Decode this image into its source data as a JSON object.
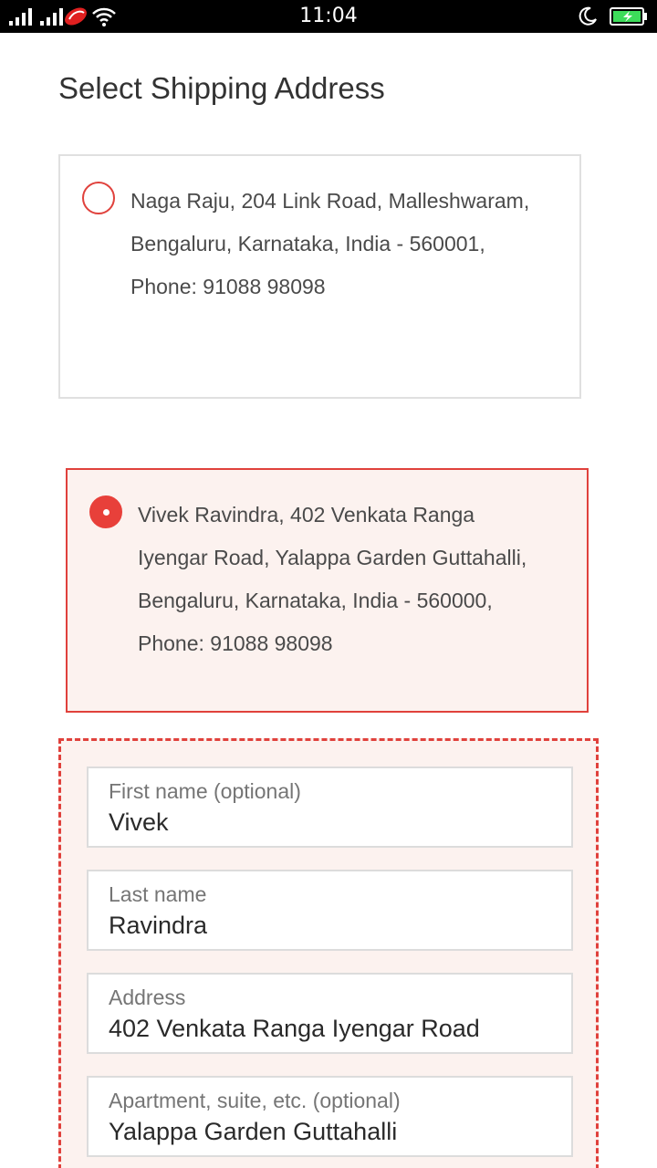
{
  "status_bar": {
    "time": "11:04"
  },
  "page": {
    "title": "Select Shipping Address"
  },
  "addresses": [
    {
      "text": "Naga Raju, 204 Link Road, Malleshwaram, Bengaluru, Karnataka, India - 560001, Phone: 91088 98098",
      "selected": false
    },
    {
      "text": "Vivek Ravindra, 402 Venkata Ranga Iyengar Road, Yalappa Garden Guttahalli, Bengaluru, Karnataka, India - 560000, Phone: 91088 98098",
      "selected": true
    }
  ],
  "form": {
    "first_name": {
      "label": "First name (optional)",
      "value": "Vivek"
    },
    "last_name": {
      "label": "Last name",
      "value": "Ravindra"
    },
    "address": {
      "label": "Address",
      "value": "402 Venkata Ranga Iyengar Road"
    },
    "apartment": {
      "label": "Apartment, suite, etc. (optional)",
      "value": "Yalappa Garden Guttahalli"
    }
  },
  "colors": {
    "accent": "#e0413c",
    "selected_bg": "#fcf2ef",
    "status_bar_bg": "#000000",
    "battery": "#3ddc5a"
  },
  "icons": [
    "signal-icon",
    "carrier-icon",
    "wifi-icon",
    "moon-icon",
    "battery-icon"
  ]
}
